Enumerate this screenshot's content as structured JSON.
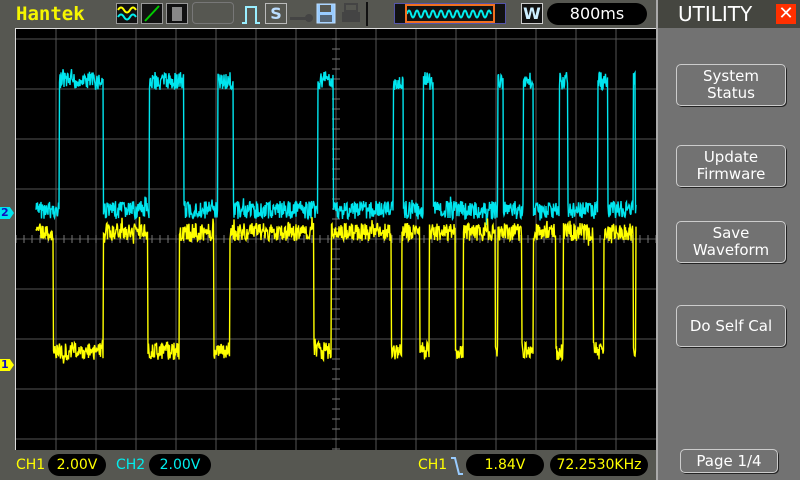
{
  "header": {
    "brand": "Hantek",
    "timebase": "800ms",
    "window_badge": "W",
    "save_icon_letter": "S"
  },
  "panel": {
    "title": "UTILITY",
    "buttons": [
      {
        "label1": "System",
        "label2": "Status"
      },
      {
        "label1": "Update",
        "label2": "Firmware"
      },
      {
        "label1": "Save",
        "label2": "Waveform"
      },
      {
        "label1": "Do Self Cal",
        "label2": ""
      }
    ],
    "page": "Page 1/4"
  },
  "status": {
    "ch1_label": "CH1",
    "ch1_scale": "2.00V",
    "ch2_label": "CH2",
    "ch2_scale": "2.00V",
    "trigger_source": "CH1",
    "trigger_level": "1.84V",
    "frequency": "72.2530KHz"
  },
  "markers": {
    "ch1": "1",
    "ch2": "2"
  },
  "colors": {
    "ch1": "#ffff00",
    "ch2": "#00e5ee",
    "brand": "#f6f600",
    "close": "#ff3000"
  },
  "waveform": {
    "ch1": {
      "idle": "high",
      "start_div": 0.5,
      "end_div": 15.5,
      "low_intervals_div": [
        [
          0.93,
          2.18
        ],
        [
          3.3,
          4.08
        ],
        [
          4.95,
          5.35
        ],
        [
          7.45,
          7.88
        ],
        [
          9.38,
          9.65
        ],
        [
          10.1,
          10.33
        ],
        [
          10.98,
          11.18
        ],
        [
          11.98,
          12.05
        ],
        [
          12.65,
          12.93
        ],
        [
          13.5,
          13.68
        ],
        [
          14.43,
          14.7
        ],
        [
          15.43,
          15.5
        ]
      ]
    },
    "ch2": {
      "idle": "low",
      "start_div": 0.5,
      "end_div": 15.5,
      "high_intervals_div": [
        [
          1.08,
          2.18
        ],
        [
          3.33,
          4.2
        ],
        [
          5.05,
          5.43
        ],
        [
          7.55,
          7.93
        ],
        [
          9.43,
          9.68
        ],
        [
          10.18,
          10.43
        ],
        [
          12.05,
          12.18
        ],
        [
          12.68,
          12.93
        ],
        [
          13.58,
          13.8
        ],
        [
          14.55,
          14.8
        ],
        [
          15.43,
          15.48
        ]
      ]
    }
  }
}
